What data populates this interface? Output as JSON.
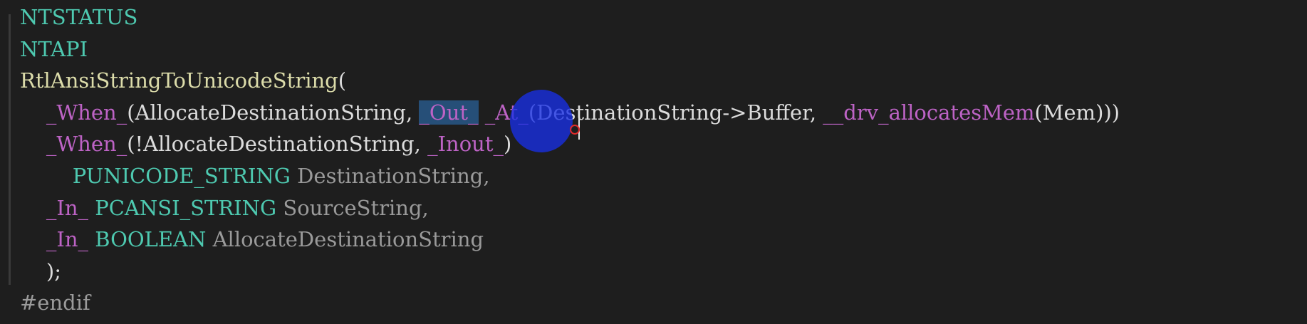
{
  "editor": {
    "lines": [
      {
        "tokens": [
          {
            "text": "NTSTATUS",
            "kind": "type"
          }
        ]
      },
      {
        "tokens": [
          {
            "text": "NTAPI",
            "kind": "type"
          }
        ]
      },
      {
        "tokens": [
          {
            "text": "RtlAnsiStringToUnicodeString",
            "kind": "fn"
          },
          {
            "text": "(",
            "kind": "plain"
          }
        ]
      },
      {
        "tokens": [
          {
            "text": "    ",
            "kind": "dots"
          },
          {
            "text": "_When_",
            "kind": "macro"
          },
          {
            "text": "(AllocateDestinationString, ",
            "kind": "plain"
          },
          {
            "text": "_Out_",
            "kind": "sel"
          },
          {
            "text": " ",
            "kind": "plain"
          },
          {
            "text": "_At_",
            "kind": "macro"
          },
          {
            "text": "(DestinationString->Buffer, ",
            "kind": "plain"
          },
          {
            "text": "__drv_allocatesMem",
            "kind": "macro"
          },
          {
            "text": "(Mem)))",
            "kind": "plain"
          }
        ]
      },
      {
        "tokens": [
          {
            "text": "    ",
            "kind": "dots"
          },
          {
            "text": "_When_",
            "kind": "macro"
          },
          {
            "text": "(!AllocateDestinationString, ",
            "kind": "plain"
          },
          {
            "text": "_Inout_",
            "kind": "macro"
          },
          {
            "text": ")",
            "kind": "plain"
          }
        ]
      },
      {
        "tokens": [
          {
            "text": "        ",
            "kind": "dots"
          },
          {
            "text": "PUNICODE_STRING",
            "kind": "type"
          },
          {
            "text": " DestinationString,",
            "kind": "param"
          }
        ]
      },
      {
        "tokens": [
          {
            "text": "    ",
            "kind": "dots"
          },
          {
            "text": "_In_",
            "kind": "macro"
          },
          {
            "text": " ",
            "kind": "plain"
          },
          {
            "text": "PCANSI_STRING",
            "kind": "type"
          },
          {
            "text": " SourceString,",
            "kind": "param"
          }
        ]
      },
      {
        "tokens": [
          {
            "text": "    ",
            "kind": "dots"
          },
          {
            "text": "_In_",
            "kind": "macro"
          },
          {
            "text": " ",
            "kind": "plain"
          },
          {
            "text": "BOOLEAN",
            "kind": "type"
          },
          {
            "text": " AllocateDestinationString",
            "kind": "param"
          }
        ]
      },
      {
        "tokens": [
          {
            "text": "    ",
            "kind": "dots"
          },
          {
            "text": ");",
            "kind": "plain"
          }
        ]
      },
      {
        "tokens": [
          {
            "text": "#endif",
            "kind": "pre"
          }
        ]
      }
    ]
  },
  "colors": {
    "background": "#1e1e1e",
    "type": "#4ec9b0",
    "macro": "#bd63c5",
    "function": "#dcdcaa",
    "plain": "#dcdcdc",
    "parameter": "#9a9a9a",
    "selection": "#264f78",
    "cursor_highlight": "#1830e6"
  },
  "icons": {
    "cursor": "mouse-cursor-highlight-icon"
  }
}
